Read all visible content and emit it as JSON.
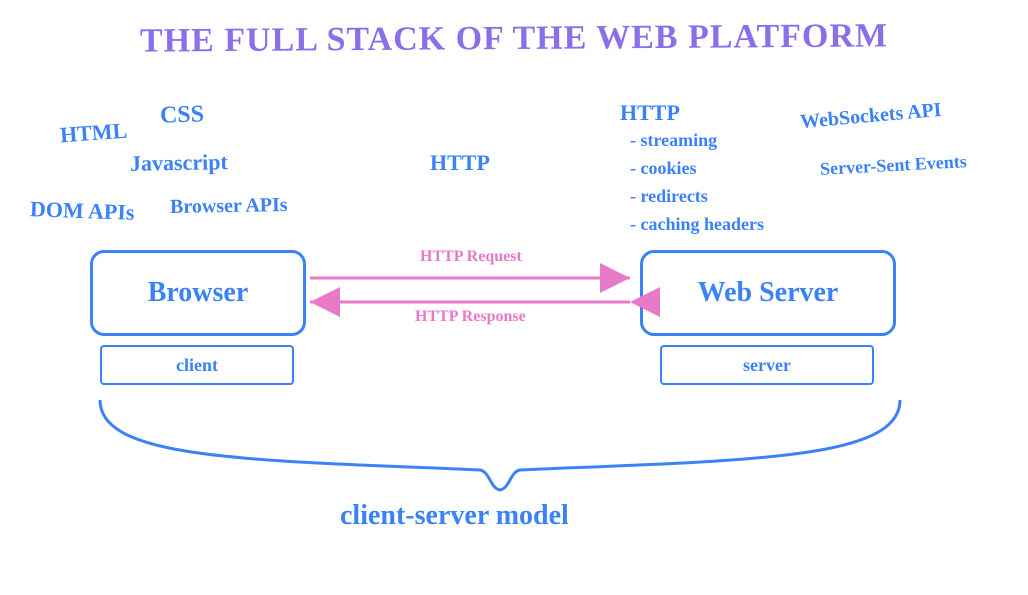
{
  "title": "THE FULL STACK OF THE WEB PLATFORM",
  "left_tech": {
    "html": "HTML",
    "css": "CSS",
    "javascript": "Javascript",
    "dom_apis": "DOM APIs",
    "browser_apis": "Browser APIs"
  },
  "middle": {
    "http": "HTTP"
  },
  "right_tech": {
    "http": "HTTP",
    "streaming": "- streaming",
    "cookies": "- cookies",
    "redirects": "- redirects",
    "caching": "- caching headers",
    "websockets": "WebSockets API",
    "sse": "Server-Sent Events"
  },
  "browser_box": "Browser",
  "client_label": "client",
  "webserver_box": "Web Server",
  "server_label": "server",
  "request_label": "HTTP Request",
  "response_label": "HTTP Response",
  "footer": "client-server model"
}
